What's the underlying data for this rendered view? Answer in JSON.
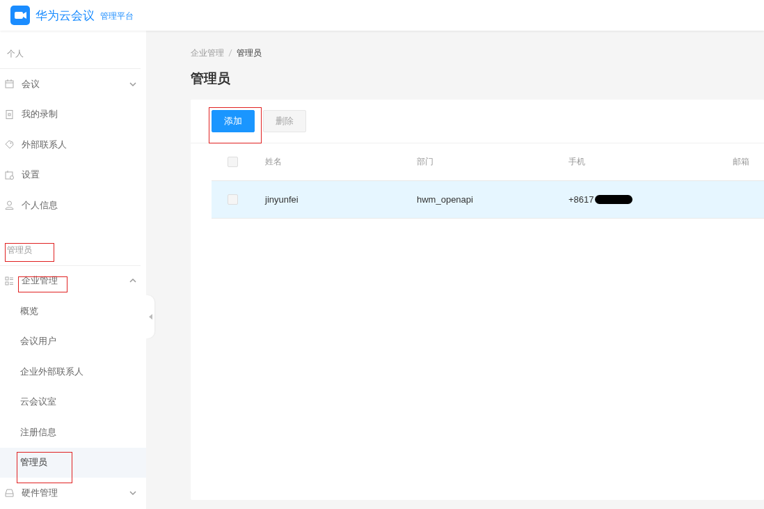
{
  "header": {
    "logo_text": "华为云会议",
    "subtitle": "管理平台"
  },
  "sidebar": {
    "sections": [
      {
        "title": "个人",
        "items": [
          {
            "label": "会议",
            "expanded": false,
            "selected": false
          },
          {
            "label": "我的录制",
            "selected": false
          },
          {
            "label": "外部联系人",
            "selected": false
          },
          {
            "label": "设置",
            "selected": false
          },
          {
            "label": "个人信息",
            "selected": false
          }
        ]
      },
      {
        "title": "管理员",
        "annotated": true,
        "items": [
          {
            "label": "企业管理",
            "expanded": true,
            "selected": false,
            "annotated": true,
            "children": [
              {
                "label": "概览",
                "selected": false,
                "annotated": false
              },
              {
                "label": "会议用户",
                "selected": false,
                "annotated": false
              },
              {
                "label": "企业外部联系人",
                "selected": false,
                "annotated": false
              },
              {
                "label": "云会议室",
                "selected": false,
                "annotated": false
              },
              {
                "label": "注册信息",
                "selected": false,
                "annotated": false
              },
              {
                "label": "管理员",
                "selected": true,
                "annotated": true
              }
            ]
          },
          {
            "label": "硬件管理",
            "expanded": false,
            "selected": false,
            "annotated": false
          }
        ]
      }
    ]
  },
  "breadcrumb": [
    "企业管理",
    "管理员"
  ],
  "page_title": "管理员",
  "toolbar": [
    {
      "label": "添加",
      "disabled": false,
      "annotated": true
    },
    {
      "label": "删除",
      "disabled": true,
      "annotated": false
    }
  ],
  "table": {
    "header_checked": false,
    "columns": [
      "姓名",
      "部门",
      "手机",
      "邮箱"
    ],
    "rows": [
      {
        "checked": false,
        "highlighted": true,
        "cells": [
          {
            "text": "jinyunfei"
          },
          {
            "text": "hwm_openapi"
          },
          {
            "text": "+8617",
            "redacted": true
          }
        ]
      }
    ]
  }
}
